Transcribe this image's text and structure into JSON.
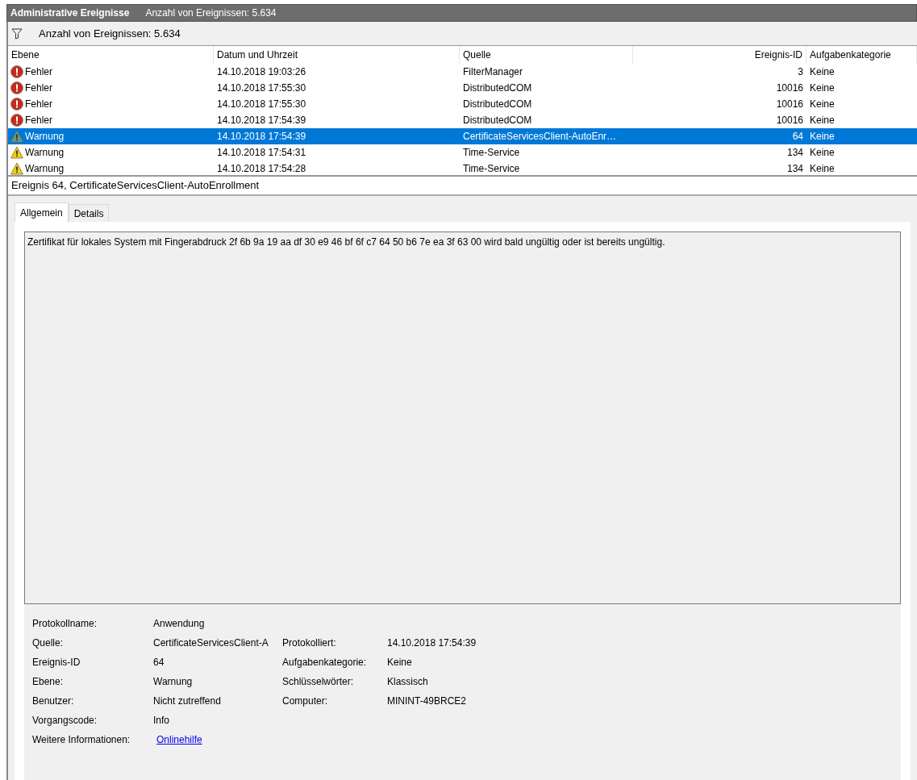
{
  "title_bar": {
    "title": "Administrative Ereignisse",
    "count": "Anzahl von Ereignissen: 5.634"
  },
  "filter_bar": {
    "text": "Anzahl von Ereignissen: 5.634"
  },
  "table": {
    "columns": [
      "Ebene",
      "Datum und Uhrzeit",
      "Quelle",
      "Ereignis-ID",
      "Aufgabenkategorie"
    ],
    "rows": [
      {
        "kind": "error",
        "level_text": "Fehler",
        "date": "14.10.2018 19:03:26",
        "source": "FilterManager",
        "id": "3",
        "category": "Keine",
        "selected": false
      },
      {
        "kind": "error",
        "level_text": "Fehler",
        "date": "14.10.2018 17:55:30",
        "source": "DistributedCOM",
        "id": "10016",
        "category": "Keine",
        "selected": false
      },
      {
        "kind": "error",
        "level_text": "Fehler",
        "date": "14.10.2018 17:55:30",
        "source": "DistributedCOM",
        "id": "10016",
        "category": "Keine",
        "selected": false
      },
      {
        "kind": "error",
        "level_text": "Fehler",
        "date": "14.10.2018 17:54:39",
        "source": "DistributedCOM",
        "id": "10016",
        "category": "Keine",
        "selected": false
      },
      {
        "kind": "warning",
        "level_text": "Warnung",
        "date": "14.10.2018 17:54:39",
        "source": "CertificateServicesClient-AutoEnr…",
        "id": "64",
        "category": "Keine",
        "selected": true
      },
      {
        "kind": "warning",
        "level_text": "Warnung",
        "date": "14.10.2018 17:54:31",
        "source": "Time-Service",
        "id": "134",
        "category": "Keine",
        "selected": false
      },
      {
        "kind": "warning",
        "level_text": "Warnung",
        "date": "14.10.2018 17:54:28",
        "source": "Time-Service",
        "id": "134",
        "category": "Keine",
        "selected": false
      }
    ]
  },
  "detail": {
    "header": "Ereignis 64, CertificateServicesClient-AutoEnrollment",
    "tabs": [
      {
        "label": "Allgemein",
        "selected": true
      },
      {
        "label": "Details",
        "selected": false
      }
    ],
    "message": "Zertifikat für lokales System mit Fingerabdruck 2f 6b 9a 19 aa df 30 e9 46 bf 6f c7 64 50 b6 7e ea 3f 63 00 wird bald ungültig oder ist bereits ungültig.",
    "properties_left": [
      {
        "label": "Protokollname:",
        "value": "Anwendung"
      },
      {
        "label": "Quelle:",
        "value": "CertificateServicesClient-A"
      },
      {
        "label": "Ereignis-ID",
        "value": "64"
      },
      {
        "label": "Ebene:",
        "value": "Warnung"
      },
      {
        "label": "Benutzer:",
        "value": "Nicht zutreffend"
      },
      {
        "label": "Vorgangscode:",
        "value": "Info"
      }
    ],
    "properties_right": [
      {
        "label": "Protokolliert:",
        "value": "14.10.2018 17:54:39"
      },
      {
        "label": "Aufgabenkategorie:",
        "value": "Keine"
      },
      {
        "label": "Schlüsselwörter:",
        "value": "Klassisch"
      },
      {
        "label": "Computer:",
        "value": "MININT-49BRCE2"
      }
    ],
    "more_info": {
      "label": "Weitere Informationen:",
      "link": "Onlinehilfe"
    }
  }
}
